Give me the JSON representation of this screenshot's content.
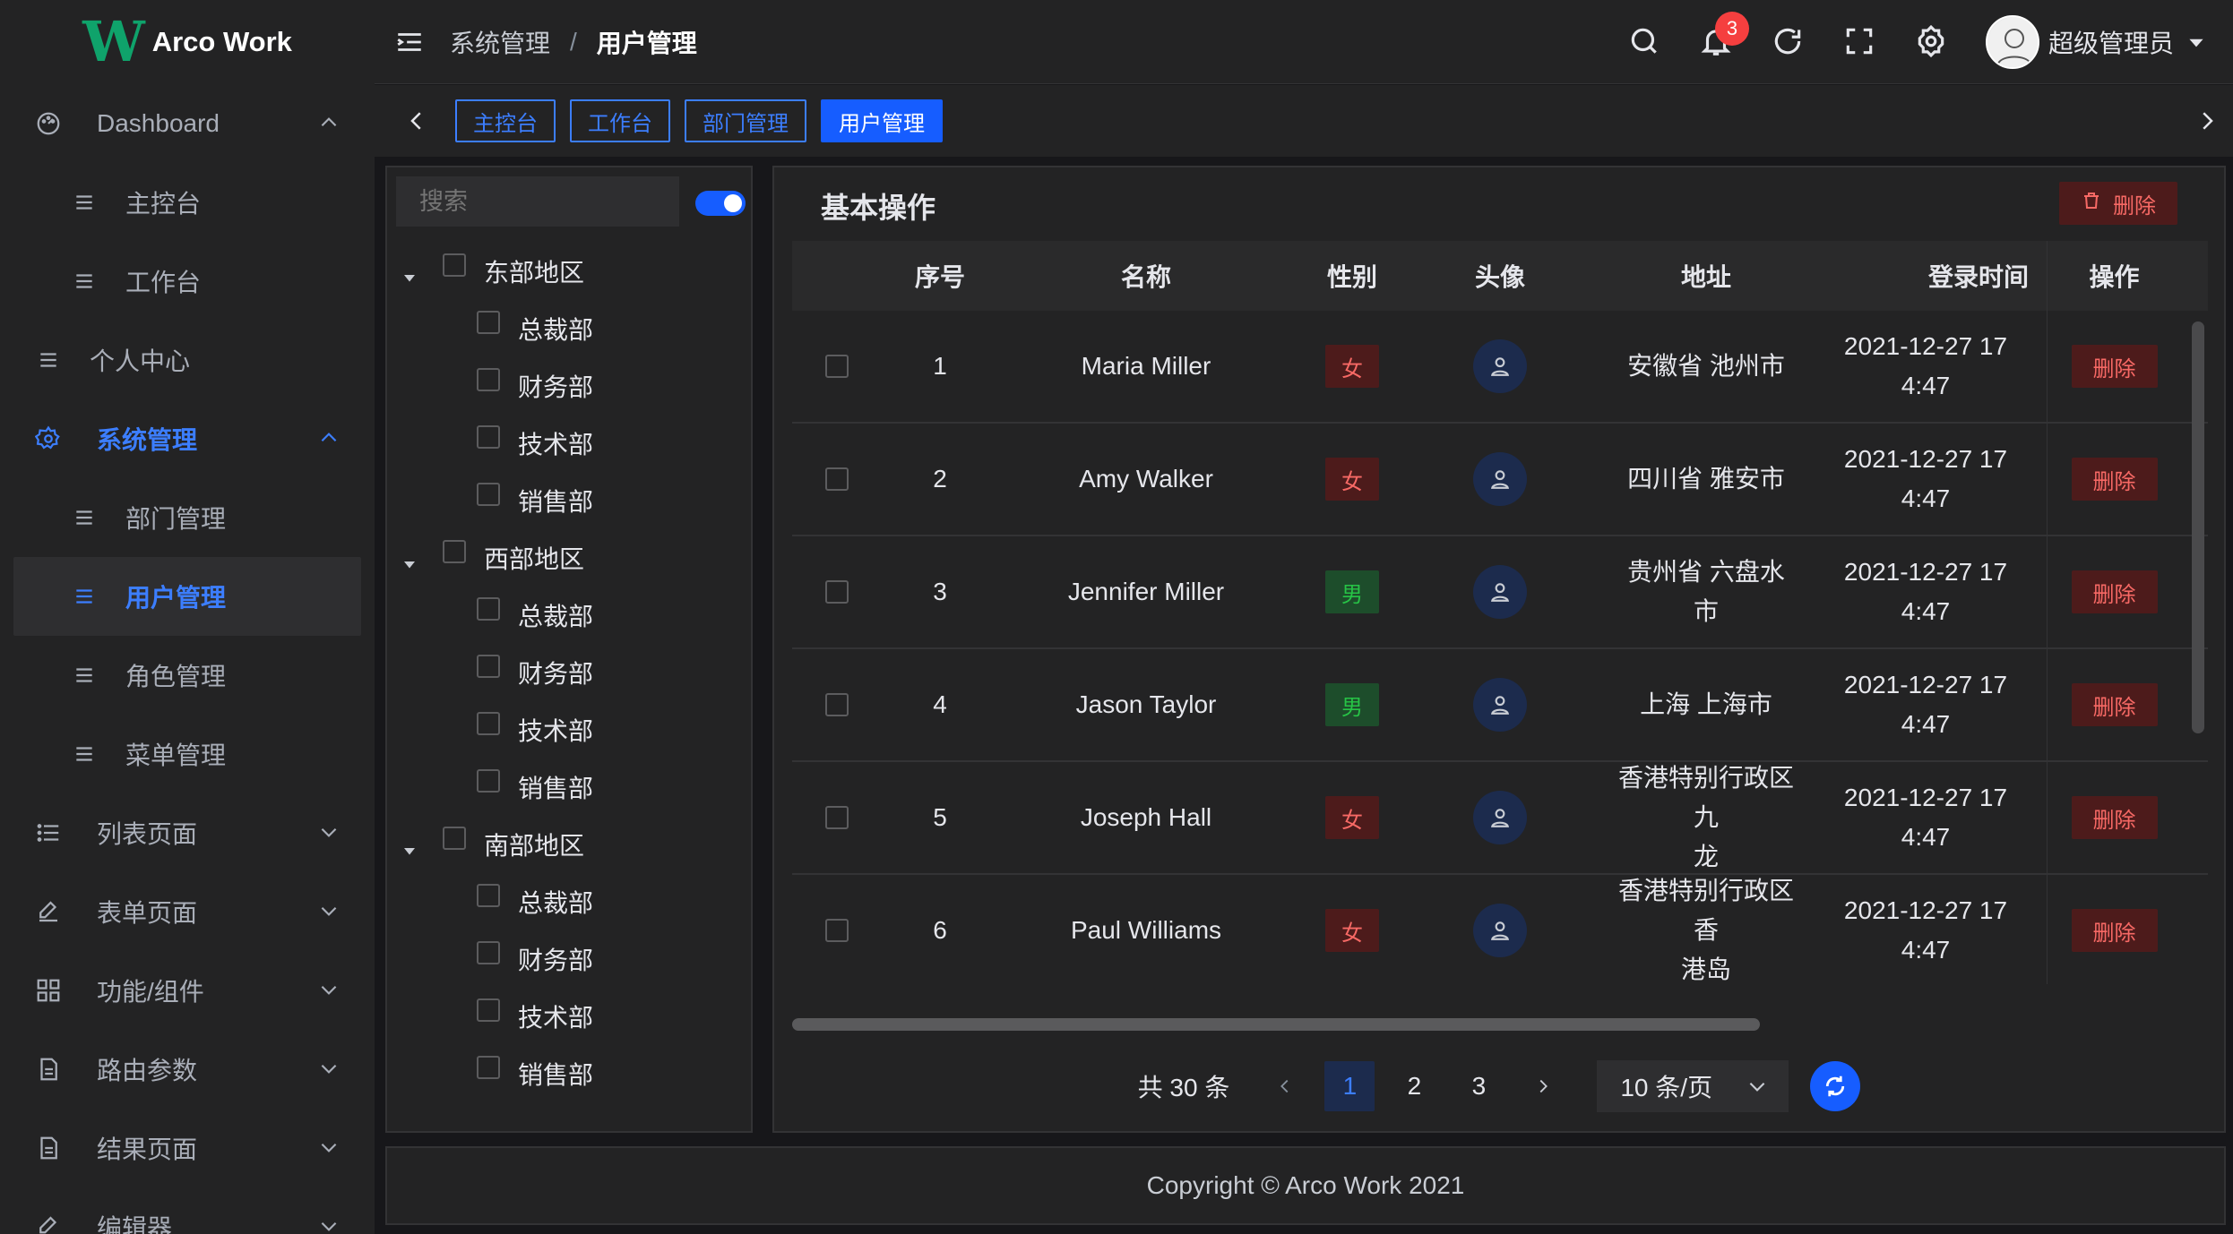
{
  "app": {
    "logo_mark": "W",
    "logo_text": "Arco Work"
  },
  "sidebar": {
    "items": [
      {
        "label": "Dashboard",
        "icon": "dashboard-icon"
      },
      {
        "label": "主控台",
        "icon": "menu-icon"
      },
      {
        "label": "工作台",
        "icon": "menu-icon"
      },
      {
        "label": "个人中心",
        "icon": "menu-icon"
      },
      {
        "label": "系统管理",
        "icon": "gear-icon"
      },
      {
        "label": "部门管理",
        "icon": "menu-icon"
      },
      {
        "label": "用户管理",
        "icon": "menu-icon"
      },
      {
        "label": "角色管理",
        "icon": "menu-icon"
      },
      {
        "label": "菜单管理",
        "icon": "menu-icon"
      },
      {
        "label": "列表页面",
        "icon": "list-icon"
      },
      {
        "label": "表单页面",
        "icon": "edit-icon"
      },
      {
        "label": "功能/组件",
        "icon": "apps-icon"
      },
      {
        "label": "路由参数",
        "icon": "file-icon"
      },
      {
        "label": "结果页面",
        "icon": "file-icon"
      },
      {
        "label": "编辑器",
        "icon": "edit-icon"
      }
    ]
  },
  "header": {
    "breadcrumb": [
      "系统管理",
      "用户管理"
    ],
    "breadcrumb_sep": "/",
    "notification_count": "3",
    "username": "超级管理员"
  },
  "tags": [
    "主控台",
    "工作台",
    "部门管理",
    "用户管理"
  ],
  "tree": {
    "search_placeholder": "搜索",
    "regions": [
      {
        "name": "东部地区",
        "children": [
          "总裁部",
          "财务部",
          "技术部",
          "销售部"
        ]
      },
      {
        "name": "西部地区",
        "children": [
          "总裁部",
          "财务部",
          "技术部",
          "销售部"
        ]
      },
      {
        "name": "南部地区",
        "children": [
          "总裁部",
          "财务部",
          "技术部",
          "销售部"
        ]
      }
    ]
  },
  "main": {
    "title": "基本操作",
    "delete_label": "删除",
    "columns": [
      "序号",
      "名称",
      "性别",
      "头像",
      "地址",
      "登录时间",
      "操作"
    ],
    "rows": [
      {
        "no": "1",
        "name": "Maria Miller",
        "gender": "女",
        "gender_type": "f",
        "addr1": "安徽省 池州市",
        "addr2": "",
        "time1": "2021-12-27 17",
        "time2": "4:47",
        "action": "删除"
      },
      {
        "no": "2",
        "name": "Amy Walker",
        "gender": "女",
        "gender_type": "f",
        "addr1": "四川省 雅安市",
        "addr2": "",
        "time1": "2021-12-27 17",
        "time2": "4:47",
        "action": "删除"
      },
      {
        "no": "3",
        "name": "Jennifer Miller",
        "gender": "男",
        "gender_type": "m",
        "addr1": "贵州省 六盘水市",
        "addr2": "",
        "time1": "2021-12-27 17",
        "time2": "4:47",
        "action": "删除"
      },
      {
        "no": "4",
        "name": "Jason Taylor",
        "gender": "男",
        "gender_type": "m",
        "addr1": "上海 上海市",
        "addr2": "",
        "time1": "2021-12-27 17",
        "time2": "4:47",
        "action": "删除"
      },
      {
        "no": "5",
        "name": "Joseph Hall",
        "gender": "女",
        "gender_type": "f",
        "addr1": "香港特别行政区 九",
        "addr2": "龙",
        "time1": "2021-12-27 17",
        "time2": "4:47",
        "action": "删除"
      },
      {
        "no": "6",
        "name": "Paul Williams",
        "gender": "女",
        "gender_type": "f",
        "addr1": "香港特别行政区 香",
        "addr2": "港岛",
        "time1": "2021-12-27 17",
        "time2": "4:47",
        "action": "删除"
      }
    ]
  },
  "pagination": {
    "total": "共 30 条",
    "pages": [
      "1",
      "2",
      "3"
    ],
    "current": "1",
    "page_size": "10 条/页"
  },
  "footer": {
    "copyright": "Copyright © Arco Work 2021"
  },
  "colors": {
    "accent": "#165dff",
    "danger": "#f53f3f",
    "success": "#27c346",
    "brand": "#0fa36b"
  }
}
